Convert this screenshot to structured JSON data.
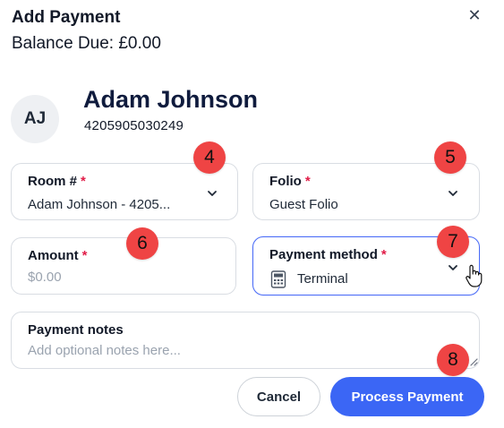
{
  "dialog": {
    "title": "Add Payment",
    "balance": "Balance Due: £0.00"
  },
  "guest": {
    "initials": "AJ",
    "name": "Adam Johnson",
    "id": "4205905030249"
  },
  "fields": {
    "room": {
      "label": "Room #",
      "required": "*",
      "value": "Adam Johnson - 4205..."
    },
    "folio": {
      "label": "Folio",
      "required": "*",
      "value": "Guest Folio"
    },
    "amount": {
      "label": "Amount",
      "required": "*",
      "placeholder": "$0.00"
    },
    "payment_method": {
      "label": "Payment method",
      "required": "*",
      "value": "Terminal"
    },
    "notes": {
      "label": "Payment notes",
      "placeholder": "Add optional notes here..."
    }
  },
  "markers": [
    "4",
    "5",
    "6",
    "7",
    "8"
  ],
  "buttons": {
    "cancel": "Cancel",
    "process": "Process Payment"
  },
  "colors": {
    "accent": "#3b66f5",
    "required": "#e11d48",
    "marker": "#ef4444"
  }
}
